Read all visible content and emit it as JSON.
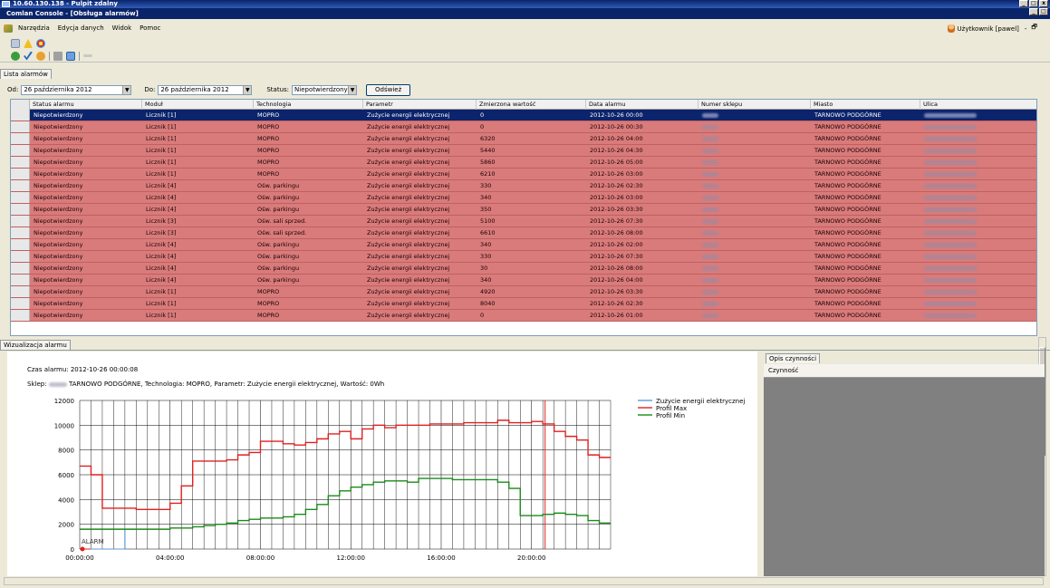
{
  "remote_desktop": {
    "title": "10.60.130.138 - Pulpit zdalny"
  },
  "app": {
    "title": "Comlan Console - [Obsługa alarmów]"
  },
  "menu": [
    "Narzędzia",
    "Edycja danych",
    "Widok",
    "Pomoc"
  ],
  "user": {
    "label": "Użytkownik [pawel]"
  },
  "tabs": {
    "alarm_list": "Lista alarmów",
    "alarm_viz": "Wizualizacja alarmu",
    "action_desc": "Opis czynności"
  },
  "filter": {
    "from_label": "Od:",
    "from_value": "26 października 2012",
    "to_label": "Do:",
    "to_value": "26 października 2012",
    "status_label": "Status:",
    "status_value": "Niepotwierdzony",
    "refresh_button": "Odśwież"
  },
  "grid": {
    "columns": [
      "Status alarmu",
      "Moduł",
      "Technologia",
      "Parametr",
      "Zmierzona wartość",
      "Data alarmu",
      "Numer sklepu",
      "Miasto",
      "Ulica"
    ],
    "rows": [
      {
        "status": "Niepotwierdzony",
        "module": "Licznik [1]",
        "tech": "MOPRO",
        "param": "Zużycie energii elektrycznej",
        "value": "0",
        "date": "2012-10-26 00:00",
        "city": "TARNOWO PODGÓRNE",
        "selected": true
      },
      {
        "status": "Niepotwierdzony",
        "module": "Licznik [1]",
        "tech": "MOPRO",
        "param": "Zużycie energii elektrycznej",
        "value": "0",
        "date": "2012-10-26 00:30",
        "city": "TARNOWO PODGÓRNE"
      },
      {
        "status": "Niepotwierdzony",
        "module": "Licznik [1]",
        "tech": "MOPRO",
        "param": "Zużycie energii elektrycznej",
        "value": "6320",
        "date": "2012-10-26 04:00",
        "city": "TARNOWO PODGÓRNE"
      },
      {
        "status": "Niepotwierdzony",
        "module": "Licznik [1]",
        "tech": "MOPRO",
        "param": "Zużycie energii elektrycznej",
        "value": "5440",
        "date": "2012-10-26 04:30",
        "city": "TARNOWO PODGÓRNE"
      },
      {
        "status": "Niepotwierdzony",
        "module": "Licznik [1]",
        "tech": "MOPRO",
        "param": "Zużycie energii elektrycznej",
        "value": "5860",
        "date": "2012-10-26 05:00",
        "city": "TARNOWO PODGÓRNE"
      },
      {
        "status": "Niepotwierdzony",
        "module": "Licznik [1]",
        "tech": "MOPRO",
        "param": "Zużycie energii elektrycznej",
        "value": "6210",
        "date": "2012-10-26 03:00",
        "city": "TARNOWO PODGÓRNE"
      },
      {
        "status": "Niepotwierdzony",
        "module": "Licznik [4]",
        "tech": "Ośw. parkingu",
        "param": "Zużycie energii elektrycznej",
        "value": "330",
        "date": "2012-10-26 02:30",
        "city": "TARNOWO PODGÓRNE"
      },
      {
        "status": "Niepotwierdzony",
        "module": "Licznik [4]",
        "tech": "Ośw. parkingu",
        "param": "Zużycie energii elektrycznej",
        "value": "340",
        "date": "2012-10-26 03:00",
        "city": "TARNOWO PODGÓRNE"
      },
      {
        "status": "Niepotwierdzony",
        "module": "Licznik [4]",
        "tech": "Ośw. parkingu",
        "param": "Zużycie energii elektrycznej",
        "value": "350",
        "date": "2012-10-26 03:30",
        "city": "TARNOWO PODGÓRNE"
      },
      {
        "status": "Niepotwierdzony",
        "module": "Licznik [3]",
        "tech": "Ośw. sali sprzed.",
        "param": "Zużycie energii elektrycznej",
        "value": "5100",
        "date": "2012-10-26 07:30",
        "city": "TARNOWO PODGÓRNE"
      },
      {
        "status": "Niepotwierdzony",
        "module": "Licznik [3]",
        "tech": "Ośw. sali sprzed.",
        "param": "Zużycie energii elektrycznej",
        "value": "6610",
        "date": "2012-10-26 08:00",
        "city": "TARNOWO PODGÓRNE"
      },
      {
        "status": "Niepotwierdzony",
        "module": "Licznik [4]",
        "tech": "Ośw. parkingu",
        "param": "Zużycie energii elektrycznej",
        "value": "340",
        "date": "2012-10-26 02:00",
        "city": "TARNOWO PODGÓRNE"
      },
      {
        "status": "Niepotwierdzony",
        "module": "Licznik [4]",
        "tech": "Ośw. parkingu",
        "param": "Zużycie energii elektrycznej",
        "value": "330",
        "date": "2012-10-26 07:30",
        "city": "TARNOWO PODGÓRNE"
      },
      {
        "status": "Niepotwierdzony",
        "module": "Licznik [4]",
        "tech": "Ośw. parkingu",
        "param": "Zużycie energii elektrycznej",
        "value": "30",
        "date": "2012-10-26 08:00",
        "city": "TARNOWO PODGÓRNE"
      },
      {
        "status": "Niepotwierdzony",
        "module": "Licznik [4]",
        "tech": "Ośw. parkingu",
        "param": "Zużycie energii elektrycznej",
        "value": "340",
        "date": "2012-10-26 04:00",
        "city": "TARNOWO PODGÓRNE"
      },
      {
        "status": "Niepotwierdzony",
        "module": "Licznik [1]",
        "tech": "MOPRO",
        "param": "Zużycie energii elektrycznej",
        "value": "4920",
        "date": "2012-10-26 03:30",
        "city": "TARNOWO PODGÓRNE"
      },
      {
        "status": "Niepotwierdzony",
        "module": "Licznik [1]",
        "tech": "MOPRO",
        "param": "Zużycie energii elektrycznej",
        "value": "8040",
        "date": "2012-10-26 02:30",
        "city": "TARNOWO PODGÓRNE"
      },
      {
        "status": "Niepotwierdzony",
        "module": "Licznik [1]",
        "tech": "MOPRO",
        "param": "Zużycie energii elektrycznej",
        "value": "0",
        "date": "2012-10-26 01:00",
        "city": "TARNOWO PODGÓRNE"
      }
    ]
  },
  "alarm_info": {
    "time_line": "Czas alarmu: 2012-10-26 00:00:08",
    "shop_prefix": "Sklep:",
    "shop_suffix": "TARNOWO PODGÓRNE, Technologia: MOPRO, Parametr: Zużycie energii elektrycznej, Wartość: 0Wh"
  },
  "action_panel": {
    "column": "Czynność"
  },
  "chart_data": {
    "type": "line",
    "ylim": [
      0,
      12000
    ],
    "y_ticks": [
      0,
      2000,
      4000,
      6000,
      8000,
      10000,
      12000
    ],
    "x_ticks": [
      "00:00:00",
      "04:00:00",
      "08:00:00",
      "12:00:00",
      "16:00:00",
      "20:00:00"
    ],
    "x_hours_range": [
      0,
      23.5
    ],
    "alarm_label": "ALARM",
    "colors": {
      "consumption": "#5b9bd5",
      "max": "#e02020",
      "min": "#1a8a1a",
      "alarm_line": "#e02020"
    },
    "series": [
      {
        "name": "Zużycie energii elektrycznej",
        "color": "#5b9bd5",
        "x": [
          0,
          0.5,
          1,
          1.5,
          2
        ],
        "y": [
          0,
          0,
          0,
          0,
          1600
        ]
      },
      {
        "name": "Profil Max",
        "color": "#e02020",
        "x": [
          0,
          0.5,
          1,
          1.5,
          2,
          2.5,
          3,
          3.5,
          4,
          4.5,
          5,
          5.5,
          6,
          6.5,
          7,
          7.5,
          8,
          8.5,
          9,
          9.5,
          10,
          10.5,
          11,
          11.5,
          12,
          12.5,
          13,
          13.5,
          14,
          14.5,
          15,
          15.5,
          16,
          16.5,
          17,
          17.5,
          18,
          18.5,
          19,
          19.5,
          20,
          20.5,
          21,
          21.5,
          22,
          22.5,
          23
        ],
        "y": [
          6700,
          6000,
          3300,
          3300,
          3300,
          3200,
          3200,
          3200,
          3700,
          5100,
          7100,
          7100,
          7100,
          7200,
          7600,
          7800,
          8700,
          8700,
          8500,
          8400,
          8600,
          8900,
          9300,
          9500,
          8900,
          9700,
          10000,
          9800,
          10000,
          10000,
          10000,
          10100,
          10100,
          10100,
          10200,
          10200,
          10200,
          10400,
          10200,
          10200,
          10300,
          10100,
          9500,
          9100,
          8800,
          7600,
          7400
        ]
      },
      {
        "name": "Profil Min",
        "color": "#1a8a1a",
        "x": [
          0,
          0.5,
          1,
          1.5,
          2,
          2.5,
          3,
          3.5,
          4,
          4.5,
          5,
          5.5,
          6,
          6.5,
          7,
          7.5,
          8,
          8.5,
          9,
          9.5,
          10,
          10.5,
          11,
          11.5,
          12,
          12.5,
          13,
          13.5,
          14,
          14.5,
          15,
          15.5,
          16,
          16.5,
          17,
          17.5,
          18,
          18.5,
          19,
          19.5,
          20,
          20.5,
          21,
          21.5,
          22,
          22.5,
          23
        ],
        "y": [
          1600,
          1600,
          1600,
          1600,
          1600,
          1600,
          1600,
          1600,
          1700,
          1700,
          1800,
          1900,
          2000,
          2100,
          2300,
          2400,
          2500,
          2500,
          2600,
          2800,
          3200,
          3600,
          4300,
          4700,
          5000,
          5200,
          5400,
          5500,
          5500,
          5400,
          5700,
          5700,
          5700,
          5600,
          5600,
          5600,
          5600,
          5400,
          4900,
          2700,
          2700,
          2800,
          2900,
          2800,
          2700,
          2300,
          2100
        ]
      }
    ],
    "alarm_marker_hour": 0,
    "vertical_marker_hour": 20.6,
    "blue_vertical_hour": 2
  }
}
